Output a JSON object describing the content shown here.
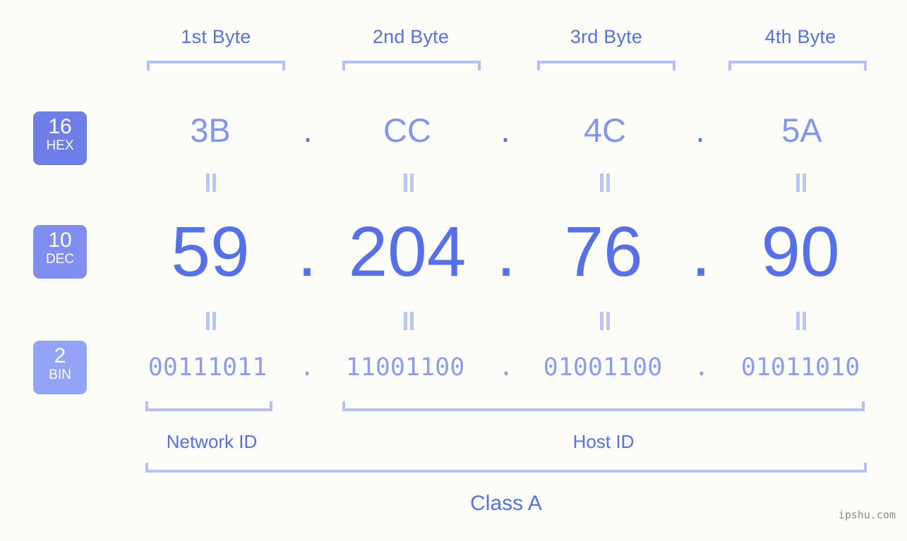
{
  "meta": {
    "watermark": "ipshu.com",
    "background_color": "#fcfdf8",
    "accent_color": "#5570e8",
    "light_accent_color": "#8295f0",
    "bracket_color": "#b4c0f8"
  },
  "byte_headers": [
    {
      "label": "1st Byte"
    },
    {
      "label": "2nd Byte"
    },
    {
      "label": "3rd Byte"
    },
    {
      "label": "4th Byte"
    }
  ],
  "bases": [
    {
      "number": "16",
      "name": "HEX",
      "color": "#6d7ee8"
    },
    {
      "number": "10",
      "name": "DEC",
      "color": "#7f8ef0"
    },
    {
      "number": "2",
      "name": "BIN",
      "color": "#93a3f5"
    }
  ],
  "rows": {
    "hex": {
      "base_number": "16",
      "base_name": "HEX",
      "values": [
        "3B",
        "CC",
        "4C",
        "5A"
      ],
      "separator": "."
    },
    "dec": {
      "base_number": "10",
      "base_name": "DEC",
      "values": [
        "59",
        "204",
        "76",
        "90"
      ],
      "separator": "."
    },
    "bin": {
      "base_number": "2",
      "base_name": "BIN",
      "values": [
        "00111011",
        "11001100",
        "01001100",
        "01011010"
      ],
      "separator": "."
    }
  },
  "equals_symbol": "=",
  "sections": {
    "network_id": "Network ID",
    "host_id": "Host ID",
    "ip_class": "Class A"
  }
}
